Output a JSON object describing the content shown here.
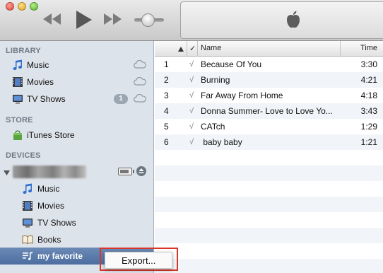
{
  "player": {
    "window_controls": [
      "close",
      "minimize",
      "zoom"
    ],
    "transport_icons": [
      "rewind-icon",
      "play-icon",
      "fast-forward-icon"
    ],
    "volume_level": 0.35,
    "display_logo": "apple-logo"
  },
  "sidebar": {
    "library_header": "LIBRARY",
    "library_items": [
      {
        "label": "Music",
        "icon": "music-note-icon",
        "cloud": true
      },
      {
        "label": "Movies",
        "icon": "film-icon",
        "cloud": true
      },
      {
        "label": "TV Shows",
        "icon": "tv-icon",
        "cloud": true,
        "badge": "1"
      }
    ],
    "store_header": "STORE",
    "store_items": [
      {
        "label": "iTunes Store",
        "icon": "shopping-bag-icon"
      }
    ],
    "devices_header": "DEVICES",
    "device": {
      "expanded": true,
      "name_obscured": true
    },
    "device_items": [
      {
        "label": "Music",
        "icon": "music-note-icon"
      },
      {
        "label": "Movies",
        "icon": "film-icon"
      },
      {
        "label": "TV Shows",
        "icon": "tv-icon"
      },
      {
        "label": "Books",
        "icon": "book-icon"
      },
      {
        "label": "my favorite",
        "icon": "playlist-icon",
        "selected": true
      }
    ]
  },
  "tracks": {
    "columns": {
      "check": "✓",
      "name": "Name",
      "time": "Time"
    },
    "rows": [
      {
        "num": "1",
        "check": "√",
        "name": "Because Of You",
        "time": "3:30"
      },
      {
        "num": "2",
        "check": "√",
        "name": "Burning",
        "time": "4:21"
      },
      {
        "num": "3",
        "check": "√",
        "name": "Far Away From Home",
        "time": "4:18"
      },
      {
        "num": "4",
        "check": "√",
        "name": "Donna Summer- Love to Love Yo...",
        "time": "3:43"
      },
      {
        "num": "5",
        "check": "√",
        "name": "CATch",
        "time": "1:29"
      },
      {
        "num": "6",
        "check": "√",
        "name": " baby baby",
        "time": "1:21"
      }
    ]
  },
  "context_menu": {
    "items": [
      "Export..."
    ],
    "highlight_color": "#d9362a"
  },
  "colors": {
    "sidebar_bg": "#dde3ea",
    "selection": "#4c6d9f",
    "row_alt": "#f1f4f8"
  }
}
